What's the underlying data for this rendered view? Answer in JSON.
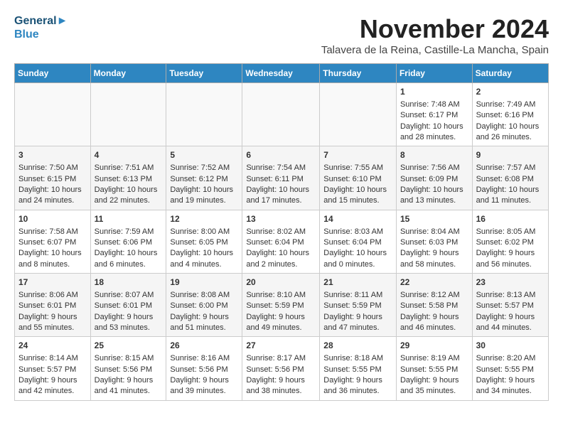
{
  "header": {
    "logo_line1": "General",
    "logo_line2": "Blue",
    "month_title": "November 2024",
    "location": "Talavera de la Reina, Castille-La Mancha, Spain"
  },
  "days_of_week": [
    "Sunday",
    "Monday",
    "Tuesday",
    "Wednesday",
    "Thursday",
    "Friday",
    "Saturday"
  ],
  "weeks": [
    [
      {
        "day": "",
        "info": ""
      },
      {
        "day": "",
        "info": ""
      },
      {
        "day": "",
        "info": ""
      },
      {
        "day": "",
        "info": ""
      },
      {
        "day": "",
        "info": ""
      },
      {
        "day": "1",
        "info": "Sunrise: 7:48 AM\nSunset: 6:17 PM\nDaylight: 10 hours and 28 minutes."
      },
      {
        "day": "2",
        "info": "Sunrise: 7:49 AM\nSunset: 6:16 PM\nDaylight: 10 hours and 26 minutes."
      }
    ],
    [
      {
        "day": "3",
        "info": "Sunrise: 7:50 AM\nSunset: 6:15 PM\nDaylight: 10 hours and 24 minutes."
      },
      {
        "day": "4",
        "info": "Sunrise: 7:51 AM\nSunset: 6:13 PM\nDaylight: 10 hours and 22 minutes."
      },
      {
        "day": "5",
        "info": "Sunrise: 7:52 AM\nSunset: 6:12 PM\nDaylight: 10 hours and 19 minutes."
      },
      {
        "day": "6",
        "info": "Sunrise: 7:54 AM\nSunset: 6:11 PM\nDaylight: 10 hours and 17 minutes."
      },
      {
        "day": "7",
        "info": "Sunrise: 7:55 AM\nSunset: 6:10 PM\nDaylight: 10 hours and 15 minutes."
      },
      {
        "day": "8",
        "info": "Sunrise: 7:56 AM\nSunset: 6:09 PM\nDaylight: 10 hours and 13 minutes."
      },
      {
        "day": "9",
        "info": "Sunrise: 7:57 AM\nSunset: 6:08 PM\nDaylight: 10 hours and 11 minutes."
      }
    ],
    [
      {
        "day": "10",
        "info": "Sunrise: 7:58 AM\nSunset: 6:07 PM\nDaylight: 10 hours and 8 minutes."
      },
      {
        "day": "11",
        "info": "Sunrise: 7:59 AM\nSunset: 6:06 PM\nDaylight: 10 hours and 6 minutes."
      },
      {
        "day": "12",
        "info": "Sunrise: 8:00 AM\nSunset: 6:05 PM\nDaylight: 10 hours and 4 minutes."
      },
      {
        "day": "13",
        "info": "Sunrise: 8:02 AM\nSunset: 6:04 PM\nDaylight: 10 hours and 2 minutes."
      },
      {
        "day": "14",
        "info": "Sunrise: 8:03 AM\nSunset: 6:04 PM\nDaylight: 10 hours and 0 minutes."
      },
      {
        "day": "15",
        "info": "Sunrise: 8:04 AM\nSunset: 6:03 PM\nDaylight: 9 hours and 58 minutes."
      },
      {
        "day": "16",
        "info": "Sunrise: 8:05 AM\nSunset: 6:02 PM\nDaylight: 9 hours and 56 minutes."
      }
    ],
    [
      {
        "day": "17",
        "info": "Sunrise: 8:06 AM\nSunset: 6:01 PM\nDaylight: 9 hours and 55 minutes."
      },
      {
        "day": "18",
        "info": "Sunrise: 8:07 AM\nSunset: 6:01 PM\nDaylight: 9 hours and 53 minutes."
      },
      {
        "day": "19",
        "info": "Sunrise: 8:08 AM\nSunset: 6:00 PM\nDaylight: 9 hours and 51 minutes."
      },
      {
        "day": "20",
        "info": "Sunrise: 8:10 AM\nSunset: 5:59 PM\nDaylight: 9 hours and 49 minutes."
      },
      {
        "day": "21",
        "info": "Sunrise: 8:11 AM\nSunset: 5:59 PM\nDaylight: 9 hours and 47 minutes."
      },
      {
        "day": "22",
        "info": "Sunrise: 8:12 AM\nSunset: 5:58 PM\nDaylight: 9 hours and 46 minutes."
      },
      {
        "day": "23",
        "info": "Sunrise: 8:13 AM\nSunset: 5:57 PM\nDaylight: 9 hours and 44 minutes."
      }
    ],
    [
      {
        "day": "24",
        "info": "Sunrise: 8:14 AM\nSunset: 5:57 PM\nDaylight: 9 hours and 42 minutes."
      },
      {
        "day": "25",
        "info": "Sunrise: 8:15 AM\nSunset: 5:56 PM\nDaylight: 9 hours and 41 minutes."
      },
      {
        "day": "26",
        "info": "Sunrise: 8:16 AM\nSunset: 5:56 PM\nDaylight: 9 hours and 39 minutes."
      },
      {
        "day": "27",
        "info": "Sunrise: 8:17 AM\nSunset: 5:56 PM\nDaylight: 9 hours and 38 minutes."
      },
      {
        "day": "28",
        "info": "Sunrise: 8:18 AM\nSunset: 5:55 PM\nDaylight: 9 hours and 36 minutes."
      },
      {
        "day": "29",
        "info": "Sunrise: 8:19 AM\nSunset: 5:55 PM\nDaylight: 9 hours and 35 minutes."
      },
      {
        "day": "30",
        "info": "Sunrise: 8:20 AM\nSunset: 5:55 PM\nDaylight: 9 hours and 34 minutes."
      }
    ]
  ]
}
